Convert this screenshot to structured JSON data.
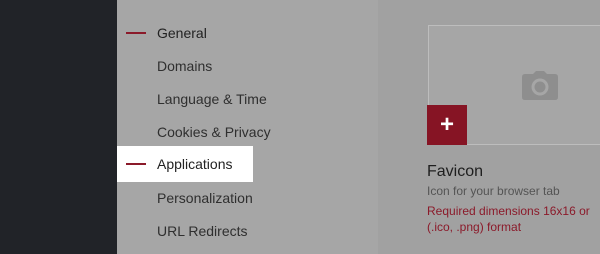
{
  "nav": {
    "items": [
      {
        "label": "General",
        "state": "active"
      },
      {
        "label": "Domains",
        "state": ""
      },
      {
        "label": "Language & Time",
        "state": ""
      },
      {
        "label": "Cookies & Privacy",
        "state": ""
      },
      {
        "label": "Applications",
        "state": "selected"
      },
      {
        "label": "Personalization",
        "state": ""
      },
      {
        "label": "URL Redirects",
        "state": ""
      }
    ]
  },
  "favicon": {
    "title": "Favicon",
    "description": "Icon for your browser tab",
    "requirement_line1": "Required dimensions 16x16 or",
    "requirement_line2": "(.ico, .png) format",
    "add_label": "+"
  },
  "icons": {
    "upload_placeholder": "camera-icon",
    "add": "plus-icon"
  },
  "colors": {
    "accent": "#8b1a2a",
    "sidebar_dark": "#212328",
    "selected_bg": "#ffffff"
  }
}
